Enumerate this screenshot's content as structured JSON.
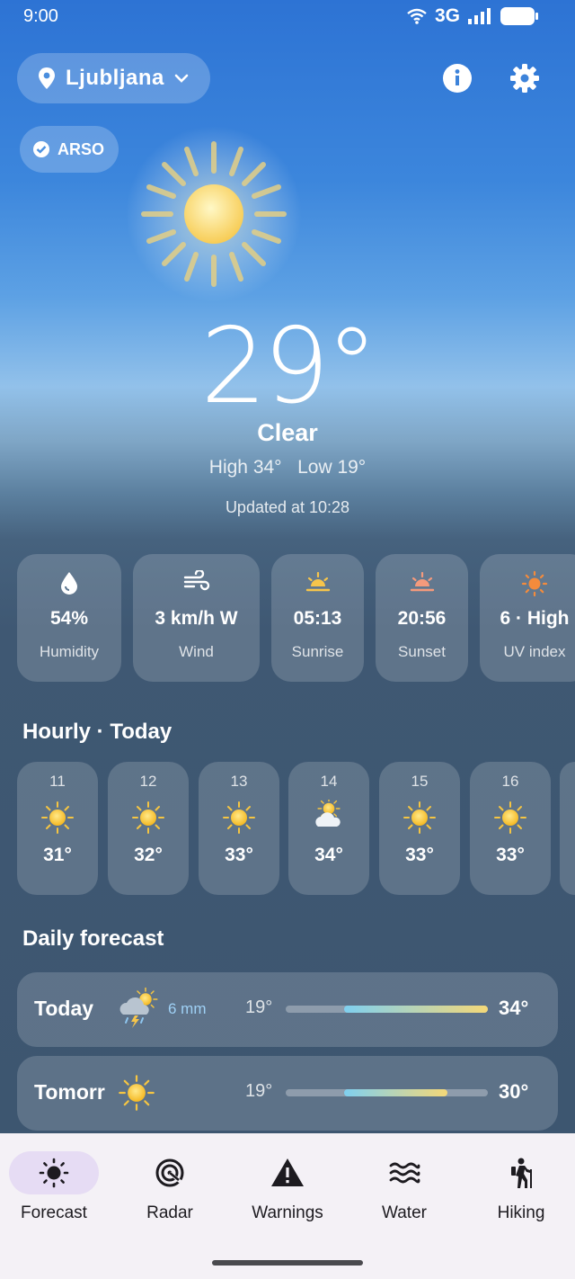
{
  "status_bar": {
    "time": "9:00",
    "network": "3G"
  },
  "header": {
    "location": "Ljubljana",
    "source_badge": "ARSO"
  },
  "current": {
    "temperature": "29°",
    "condition": "Clear",
    "high_low": "High 34°   Low 19°",
    "updated": "Updated at 10:28"
  },
  "metrics": [
    {
      "value": "54%",
      "label": "Humidity",
      "icon": "water-drop-icon"
    },
    {
      "value": "3 km/h W",
      "label": "Wind",
      "icon": "wind-icon"
    },
    {
      "value": "05:13",
      "label": "Sunrise",
      "icon": "sunrise-icon"
    },
    {
      "value": "20:56",
      "label": "Sunset",
      "icon": "sunset-icon"
    },
    {
      "value": "6 · High",
      "label": "UV index",
      "icon": "uv-sun-icon"
    }
  ],
  "hourly": {
    "title": "Hourly · Today",
    "items": [
      {
        "hour": "11",
        "temp": "31°",
        "icon": "sun-icon"
      },
      {
        "hour": "12",
        "temp": "32°",
        "icon": "sun-icon"
      },
      {
        "hour": "13",
        "temp": "33°",
        "icon": "sun-icon"
      },
      {
        "hour": "14",
        "temp": "34°",
        "icon": "partly-cloudy-icon"
      },
      {
        "hour": "15",
        "temp": "33°",
        "icon": "sun-icon"
      },
      {
        "hour": "16",
        "temp": "33°",
        "icon": "sun-icon"
      }
    ]
  },
  "daily": {
    "title": "Daily forecast",
    "items": [
      {
        "day": "Today",
        "precip": "6 mm",
        "low": "19°",
        "high": "34°",
        "icon": "thunderstorm-sun-icon",
        "range_start": 0.29,
        "range_end": 1.0
      },
      {
        "day": "Tomorr",
        "precip": "",
        "low": "19°",
        "high": "30°",
        "icon": "sun-icon",
        "range_start": 0.29,
        "range_end": 0.8
      }
    ]
  },
  "nav": [
    {
      "label": "Forecast",
      "icon": "sun-icon",
      "active": true
    },
    {
      "label": "Radar",
      "icon": "radar-icon",
      "active": false
    },
    {
      "label": "Warnings",
      "icon": "warning-icon",
      "active": false
    },
    {
      "label": "Water",
      "icon": "waves-icon",
      "active": false
    },
    {
      "label": "Hiking",
      "icon": "hiking-icon",
      "active": false
    }
  ],
  "colors": {
    "accent_nav": "#e6dcf4",
    "sun": "#f7c948",
    "precip": "#9fd0f5"
  }
}
